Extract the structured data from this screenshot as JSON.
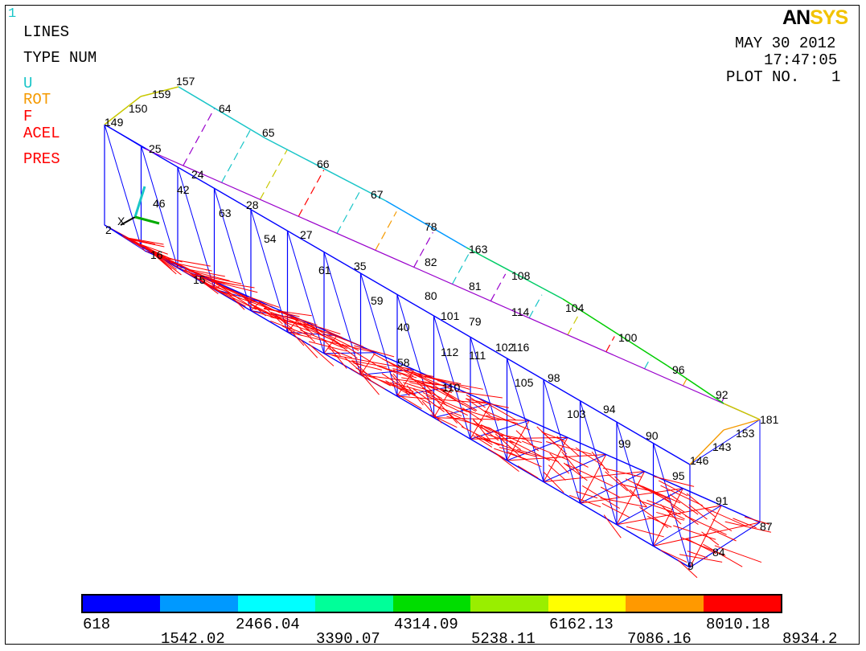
{
  "window_number": "1",
  "legend": {
    "title": "LINES",
    "subtitle": "TYPE NUM",
    "keys": [
      {
        "label": "U",
        "color": "#19c5c8"
      },
      {
        "label": "ROT",
        "color": "#f59a00"
      },
      {
        "label": "F",
        "color": "#ff0000"
      },
      {
        "label": "ACEL",
        "color": "#ff0000"
      },
      {
        "label": "PRES",
        "color": "#ff0000"
      }
    ]
  },
  "header": {
    "logo_left": "AN",
    "logo_right": "SYS",
    "date": "MAY 30 2012",
    "time": "17:47:05",
    "plot_label": "PLOT NO.",
    "plot_number": "1"
  },
  "axis_label": "X",
  "node_labels": [
    "64",
    "65",
    "66",
    "67",
    "78",
    "82",
    "81",
    "114",
    "116",
    "108",
    "104",
    "100",
    "96",
    "92",
    "181",
    "153",
    "143",
    "146",
    "91",
    "87",
    "84",
    "25",
    "24",
    "42",
    "46",
    "28",
    "54",
    "27",
    "61",
    "35",
    "59",
    "40",
    "58",
    "63",
    "105",
    "98",
    "103",
    "94",
    "99",
    "90",
    "95",
    "9",
    "2",
    "16",
    "15",
    "101",
    "102",
    "111",
    "112",
    "110",
    "79",
    "80",
    "149",
    "159",
    "150",
    "157",
    "163"
  ],
  "colorbar": {
    "colors": [
      "#0000ff",
      "#0099ff",
      "#00ffff",
      "#00ff99",
      "#00dd00",
      "#99ee00",
      "#ffff00",
      "#ff9900",
      "#ff0000"
    ],
    "top_labels": [
      "618",
      "2466.04",
      "4314.09",
      "6162.13",
      "8010.18"
    ],
    "bottom_labels": [
      "1542.02",
      "3390.07",
      "5238.11",
      "7086.16",
      "8934.2"
    ]
  }
}
